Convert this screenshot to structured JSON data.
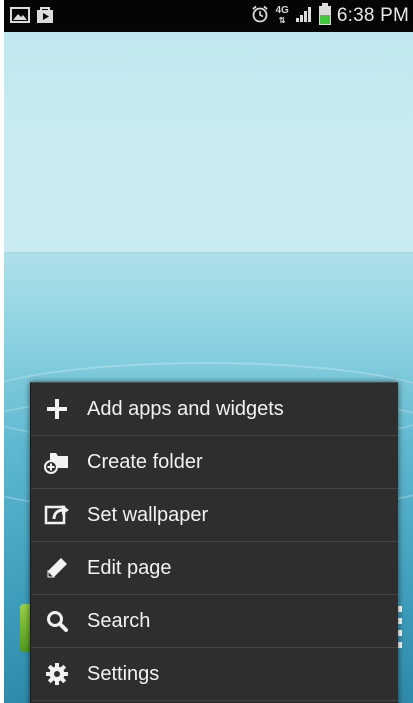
{
  "status_bar": {
    "left_icons": [
      "picture-icon",
      "play-store-icon"
    ],
    "alarm_icon": "alarm-icon",
    "network": "4G",
    "time": "6:38 PM",
    "colors": {
      "background": "#050505",
      "battery": "#41c83a"
    }
  },
  "context_menu": {
    "items": [
      {
        "label": "Add apps and widgets",
        "icon": "plus-icon"
      },
      {
        "label": "Create folder",
        "icon": "folder-add-icon"
      },
      {
        "label": "Set wallpaper",
        "icon": "wallpaper-icon"
      },
      {
        "label": "Edit page",
        "icon": "pencil-icon"
      },
      {
        "label": "Search",
        "icon": "search-icon"
      },
      {
        "label": "Settings",
        "icon": "gear-icon"
      }
    ],
    "colors": {
      "background": "#2e2e2e",
      "divider": "#454545",
      "text": "#f2f2f2"
    }
  }
}
